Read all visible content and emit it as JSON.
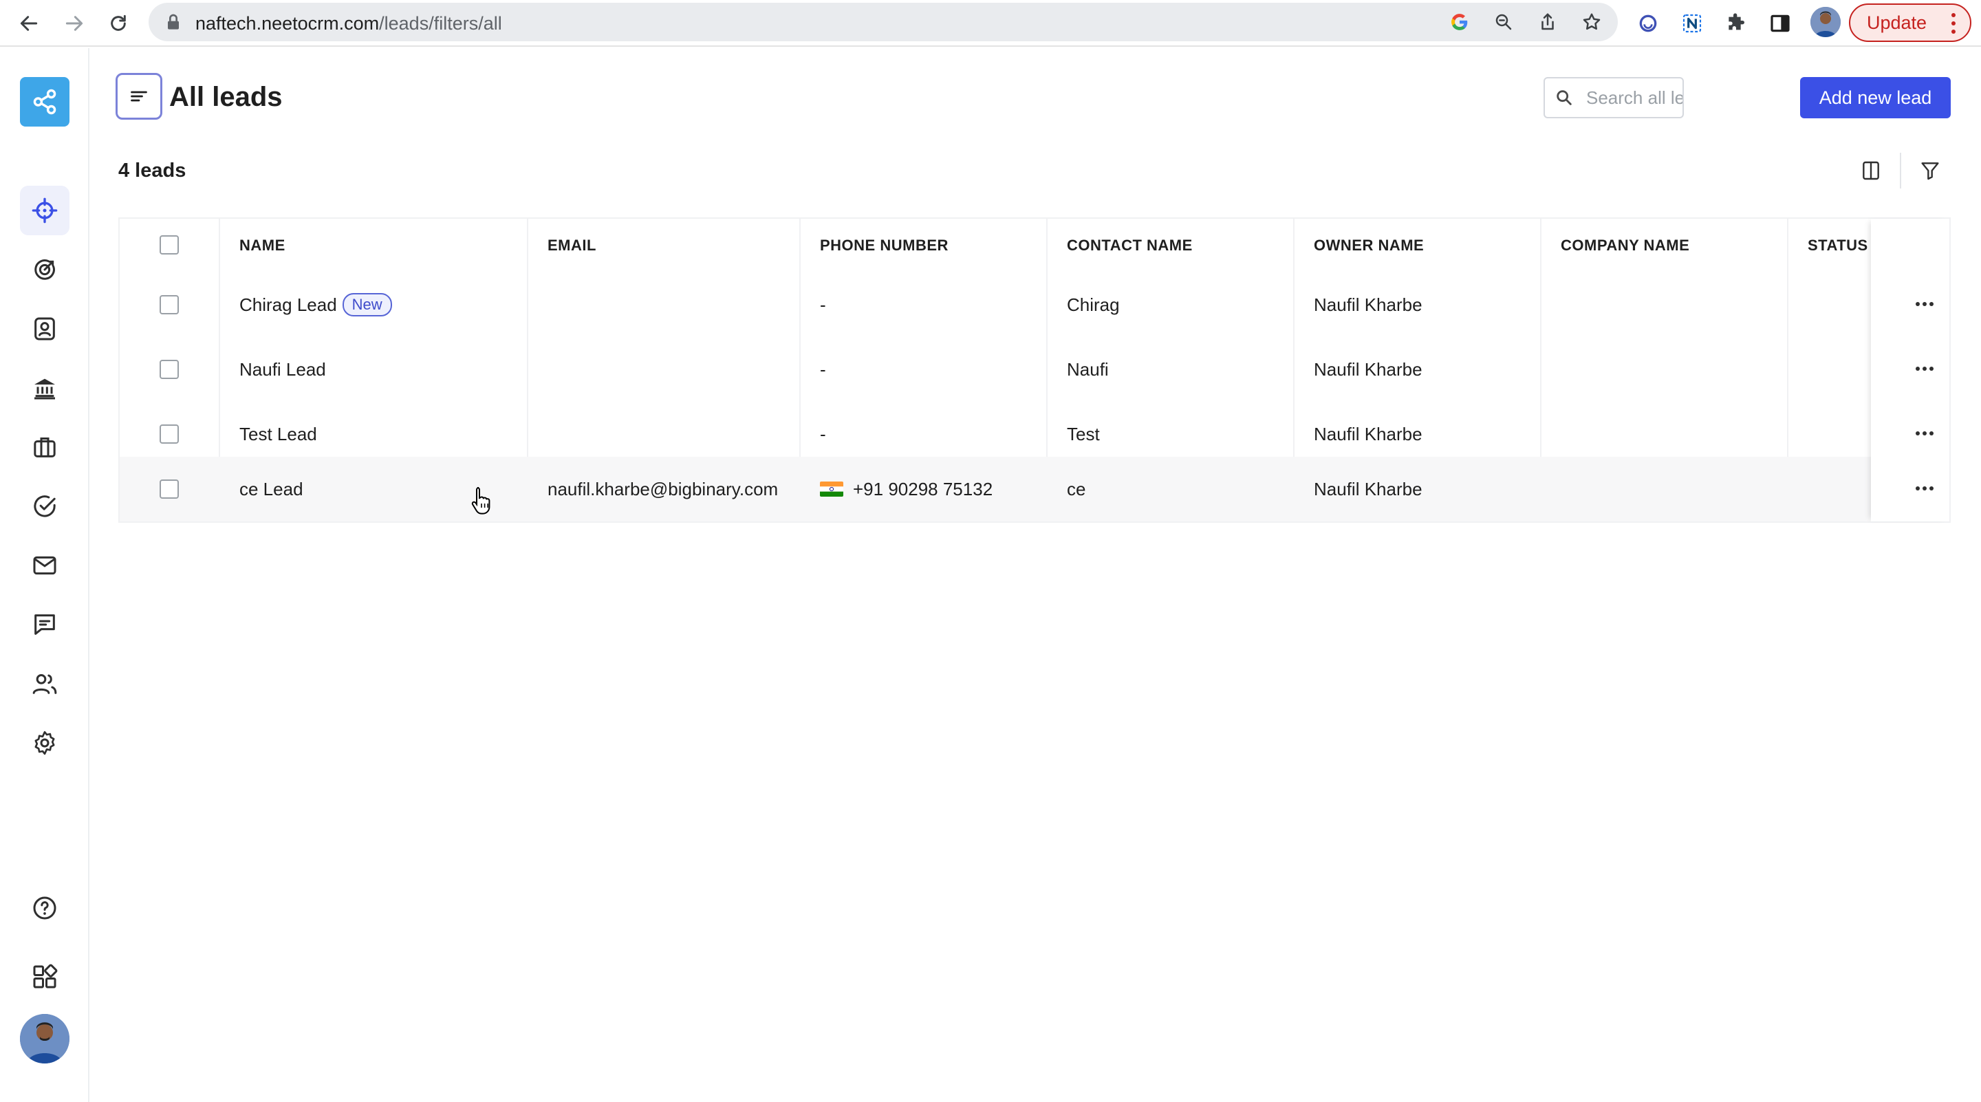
{
  "browser": {
    "url_host": "naftech.neetocrm.com",
    "url_path": "/leads/filters/all",
    "update_label": "Update",
    "icons": [
      "back-arrow-icon",
      "forward-arrow-icon",
      "reload-icon",
      "lock-icon",
      "google-icon",
      "zoom-icon",
      "share-icon",
      "star-icon",
      "extension-circle-icon",
      "neeto-n-icon",
      "puzzle-icon",
      "sidepanel-icon",
      "profile-avatar",
      "more-vert-icon"
    ]
  },
  "sidebar": {
    "icons": [
      "share-logo-icon",
      "crosshair-icon",
      "target-icon",
      "contact-card-icon",
      "bank-icon",
      "briefcase-icon",
      "check-circle-icon",
      "mail-icon",
      "chat-icon",
      "users-icon",
      "gear-icon",
      "help-icon",
      "apps-grid-icon",
      "user-avatar"
    ],
    "active_item": "leads"
  },
  "header": {
    "title": "All leads",
    "search_placeholder": "Search all leads",
    "add_button": "Add new lead"
  },
  "toolbar": {
    "count_label": "4 leads"
  },
  "table": {
    "columns": [
      "NAME",
      "EMAIL",
      "PHONE NUMBER",
      "CONTACT NAME",
      "OWNER NAME",
      "COMPANY NAME",
      "STATUS"
    ],
    "rows": [
      {
        "name": "Chirag Lead",
        "badge": "New",
        "email": "",
        "phone": "-",
        "contact": "Chirag",
        "owner": "Naufil Kharbe",
        "company": "",
        "status": ""
      },
      {
        "name": "Naufi Lead",
        "badge": "",
        "email": "",
        "phone": "-",
        "contact": "Naufi",
        "owner": "Naufil Kharbe",
        "company": "",
        "status": ""
      },
      {
        "name": "Test Lead",
        "badge": "",
        "email": "",
        "phone": "-",
        "contact": "Test",
        "owner": "Naufil Kharbe",
        "company": "",
        "status": ""
      },
      {
        "name": "ce Lead",
        "badge": "",
        "email": "naufil.kharbe@bigbinary.com",
        "phone": "+91 90298 75132",
        "phone_flag": "india-flag-icon",
        "contact": "ce",
        "owner": "Naufil Kharbe",
        "company": "",
        "status": ""
      }
    ]
  },
  "colors": {
    "primary": "#3b50e6",
    "badge_border": "#5765d6",
    "update_red": "#c5221f",
    "logo_blue": "#3ea6e8"
  }
}
